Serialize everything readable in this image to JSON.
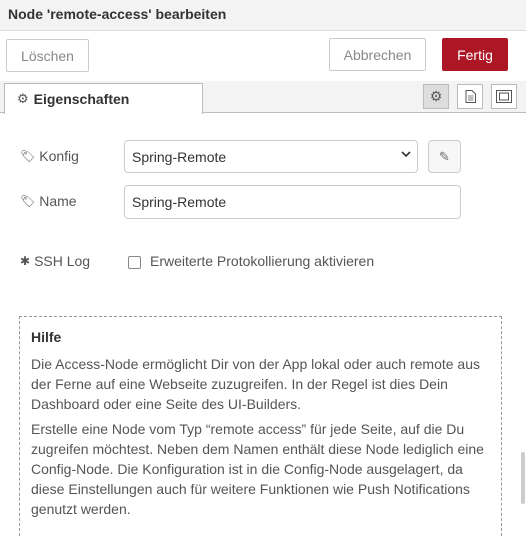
{
  "dialog": {
    "title": "Node 'remote-access' bearbeiten"
  },
  "toolbar": {
    "delete_label": "Löschen",
    "cancel_label": "Abbrechen",
    "done_label": "Fertig"
  },
  "tabs": {
    "properties_label": "Eigenschaften"
  },
  "icons": {
    "gear": "gear-icon",
    "tag": "tag-icon",
    "doc": "document-icon",
    "frame": "frame-icon",
    "bug": "bug-icon",
    "pencil": "pencil-icon"
  },
  "form": {
    "config_label": "Konfig",
    "config_value": "Spring-Remote",
    "name_label": "Name",
    "name_value": "Spring-Remote",
    "sshlog_label": "SSH Log",
    "sshlog_checkbox_label": "Erweiterte Protokollierung aktivieren"
  },
  "help": {
    "title": "Hilfe",
    "p1": "Die Access-Node ermöglicht Dir von der App lokal oder auch remote aus der Ferne auf eine Webseite zuzugreifen. In der Regel ist dies Dein Dashboard oder eine Seite des UI-Builders.",
    "p2": "Erstelle eine Node vom Typ “remote access” für jede Seite, auf die Du zugreifen möchtest. Neben dem Namen enthält diese Node lediglich eine Config-Node. Die Konfiguration ist in die Config-Node ausgelagert, da diese Einstellungen auch für weitere Funktionen wie Push Notifications genutzt werden."
  },
  "colors": {
    "primary": "#ad1625",
    "header_bg": "#f3f3f3",
    "border": "#cccccc"
  }
}
